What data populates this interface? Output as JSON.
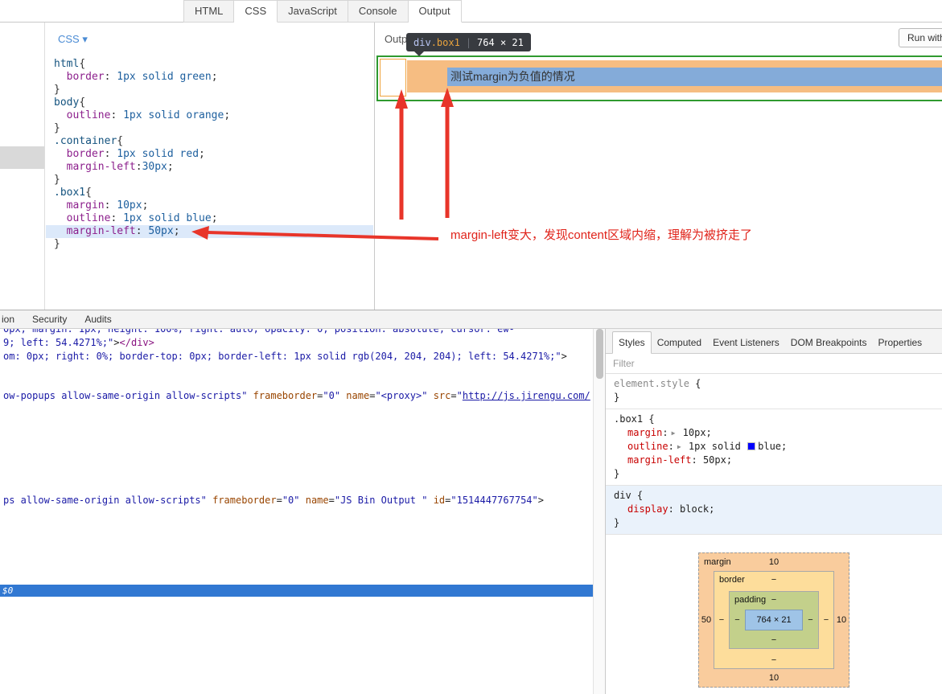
{
  "topbar": {
    "tabs": [
      {
        "label": "HTML",
        "active": false
      },
      {
        "label": "CSS",
        "active": true
      },
      {
        "label": "JavaScript",
        "active": false
      },
      {
        "label": "Console",
        "active": false
      },
      {
        "label": "Output",
        "active": true
      }
    ]
  },
  "css_panel": {
    "menu_label": "CSS",
    "menu_caret": "▾",
    "lines": [
      {
        "hl": false,
        "segs": [
          {
            "t": "html",
            "s": "sel"
          },
          {
            "t": "{",
            "s": "plain"
          }
        ]
      },
      {
        "hl": false,
        "segs": [
          {
            "t": "  ",
            "s": "plain"
          },
          {
            "t": "border",
            "s": "prop"
          },
          {
            "t": ": ",
            "s": "plain"
          },
          {
            "t": "1px solid green",
            "s": "val"
          },
          {
            "t": ";",
            "s": "plain"
          }
        ]
      },
      {
        "hl": false,
        "segs": [
          {
            "t": "}",
            "s": "plain"
          }
        ]
      },
      {
        "hl": false,
        "segs": [
          {
            "t": "body",
            "s": "sel"
          },
          {
            "t": "{",
            "s": "plain"
          }
        ]
      },
      {
        "hl": false,
        "segs": [
          {
            "t": "  ",
            "s": "plain"
          },
          {
            "t": "outline",
            "s": "prop"
          },
          {
            "t": ": ",
            "s": "plain"
          },
          {
            "t": "1px solid orange",
            "s": "val"
          },
          {
            "t": ";",
            "s": "plain"
          }
        ]
      },
      {
        "hl": false,
        "segs": [
          {
            "t": "}",
            "s": "plain"
          }
        ]
      },
      {
        "hl": false,
        "segs": [
          {
            "t": ".container",
            "s": "sel"
          },
          {
            "t": "{",
            "s": "plain"
          }
        ]
      },
      {
        "hl": false,
        "segs": [
          {
            "t": "  ",
            "s": "plain"
          },
          {
            "t": "border",
            "s": "prop"
          },
          {
            "t": ": ",
            "s": "plain"
          },
          {
            "t": "1px solid red",
            "s": "val"
          },
          {
            "t": ";",
            "s": "plain"
          }
        ]
      },
      {
        "hl": false,
        "segs": [
          {
            "t": "  ",
            "s": "plain"
          },
          {
            "t": "margin-left",
            "s": "prop"
          },
          {
            "t": ":",
            "s": "plain"
          },
          {
            "t": "30px",
            "s": "val"
          },
          {
            "t": ";",
            "s": "plain"
          }
        ]
      },
      {
        "hl": false,
        "segs": [
          {
            "t": "}",
            "s": "plain"
          }
        ]
      },
      {
        "hl": false,
        "segs": [
          {
            "t": ".box1",
            "s": "sel"
          },
          {
            "t": "{",
            "s": "plain"
          }
        ]
      },
      {
        "hl": false,
        "segs": [
          {
            "t": "  ",
            "s": "plain"
          },
          {
            "t": "margin",
            "s": "prop"
          },
          {
            "t": ": ",
            "s": "plain"
          },
          {
            "t": "10px",
            "s": "val"
          },
          {
            "t": ";",
            "s": "plain"
          }
        ]
      },
      {
        "hl": false,
        "segs": [
          {
            "t": "  ",
            "s": "plain"
          },
          {
            "t": "outline",
            "s": "prop"
          },
          {
            "t": ": ",
            "s": "plain"
          },
          {
            "t": "1px solid blue",
            "s": "val"
          },
          {
            "t": ";",
            "s": "plain"
          }
        ]
      },
      {
        "hl": true,
        "segs": [
          {
            "t": "  ",
            "s": "plain"
          },
          {
            "t": "margin-left",
            "s": "prop"
          },
          {
            "t": ": ",
            "s": "plain"
          },
          {
            "t": "50px",
            "s": "val"
          },
          {
            "t": ";",
            "s": "plain"
          }
        ]
      },
      {
        "hl": false,
        "segs": [
          {
            "t": "}",
            "s": "plain"
          }
        ]
      }
    ]
  },
  "output_panel": {
    "header_label": "Output",
    "run_button": "Run with JS",
    "tooltip": {
      "tag": "div",
      "cls": ".box1",
      "sep": "|",
      "size": "764 × 21"
    },
    "content_text": "测试margin为负值的情况"
  },
  "annotations": {
    "note": "margin-left变大，发现content区域内缩，理解为被挤走了",
    "arrow_color": "#e8352a"
  },
  "devtools": {
    "main_tabs": [
      "ion",
      "Security",
      "Audits"
    ],
    "elements": {
      "selected_marker": "$0",
      "lines": [
        {
          "segs": [
            {
              "t": "0px; margin: 1px; height: 100%; right: auto; opacity: 0; position: absolute; cursor: ew-",
              "s": "val"
            }
          ]
        },
        {
          "segs": [
            {
              "t": "9; left: 54.4271%;\"",
              "s": "val"
            },
            {
              "t": ">",
              "s": "plain"
            },
            {
              "t": "</div",
              "s": "tag"
            },
            {
              "t": ">",
              "s": "tag"
            }
          ]
        },
        {
          "segs": [
            {
              "t": "om: 0px; right: 0%; border-top: 0px; border-left: 1px solid rgb(204, 204, 204); left: 54.4271%;\"",
              "s": "val"
            },
            {
              "t": ">",
              "s": "plain"
            }
          ]
        },
        {
          "segs": [
            {
              "t": "ow-popups allow-same-origin allow-scripts\" ",
              "s": "val"
            },
            {
              "t": "frameborder",
              "s": "attr"
            },
            {
              "t": "=",
              "s": "plain"
            },
            {
              "t": "\"0\" ",
              "s": "val"
            },
            {
              "t": "name",
              "s": "attr"
            },
            {
              "t": "=",
              "s": "plain"
            },
            {
              "t": "\"<proxy>\" ",
              "s": "val"
            },
            {
              "t": "src",
              "s": "attr"
            },
            {
              "t": "=",
              "s": "plain"
            },
            {
              "t": "\"",
              "s": "val"
            },
            {
              "t": "http://js.jirengu.com/",
              "s": "link"
            }
          ]
        },
        {
          "segs": [
            {
              "t": "ps allow-same-origin allow-scripts\" ",
              "s": "val"
            },
            {
              "t": "frameborder",
              "s": "attr"
            },
            {
              "t": "=",
              "s": "plain"
            },
            {
              "t": "\"0\" ",
              "s": "val"
            },
            {
              "t": "name",
              "s": "attr"
            },
            {
              "t": "=",
              "s": "plain"
            },
            {
              "t": "\"JS Bin Output \" ",
              "s": "val"
            },
            {
              "t": "id",
              "s": "attr"
            },
            {
              "t": "=",
              "s": "plain"
            },
            {
              "t": "\"1514447767754\"",
              "s": "val"
            },
            {
              "t": ">",
              "s": "plain"
            }
          ]
        }
      ]
    },
    "styles_tabs": [
      {
        "label": "Styles",
        "active": true
      },
      {
        "label": "Computed",
        "active": false
      },
      {
        "label": "Event Listeners",
        "active": false
      },
      {
        "label": "DOM Breakpoints",
        "active": false
      },
      {
        "label": "Properties",
        "active": false
      }
    ],
    "filter_label": "Filter",
    "rules": [
      {
        "selector": "element.style",
        "muted": true,
        "highlight": false,
        "props": []
      },
      {
        "selector": ".box1",
        "muted": false,
        "highlight": false,
        "props": [
          {
            "name": "margin",
            "arrow": true,
            "parts": [
              {
                "t": " 10px;"
              }
            ]
          },
          {
            "name": "outline",
            "arrow": true,
            "parts": [
              {
                "t": " 1px solid "
              },
              {
                "swatch": "#0000ff"
              },
              {
                "t": "blue;"
              }
            ]
          },
          {
            "name": "margin-left",
            "arrow": false,
            "parts": [
              {
                "t": " 50px;"
              }
            ]
          }
        ]
      },
      {
        "selector": "div",
        "muted": false,
        "highlight": true,
        "props": [
          {
            "name": "display",
            "arrow": false,
            "parts": [
              {
                "t": " block;"
              }
            ]
          }
        ]
      }
    ],
    "metrics": {
      "margin": {
        "label": "margin",
        "top": "10",
        "left": "50",
        "right": "10",
        "bottom": "10"
      },
      "border": {
        "label": "border",
        "top": "−",
        "left": "−",
        "right": "−",
        "bottom": "−"
      },
      "padding": {
        "label": "padding",
        "top": "−",
        "left": "−",
        "right": "−",
        "bottom": "−"
      },
      "content": {
        "size": "764 × 21"
      }
    }
  }
}
